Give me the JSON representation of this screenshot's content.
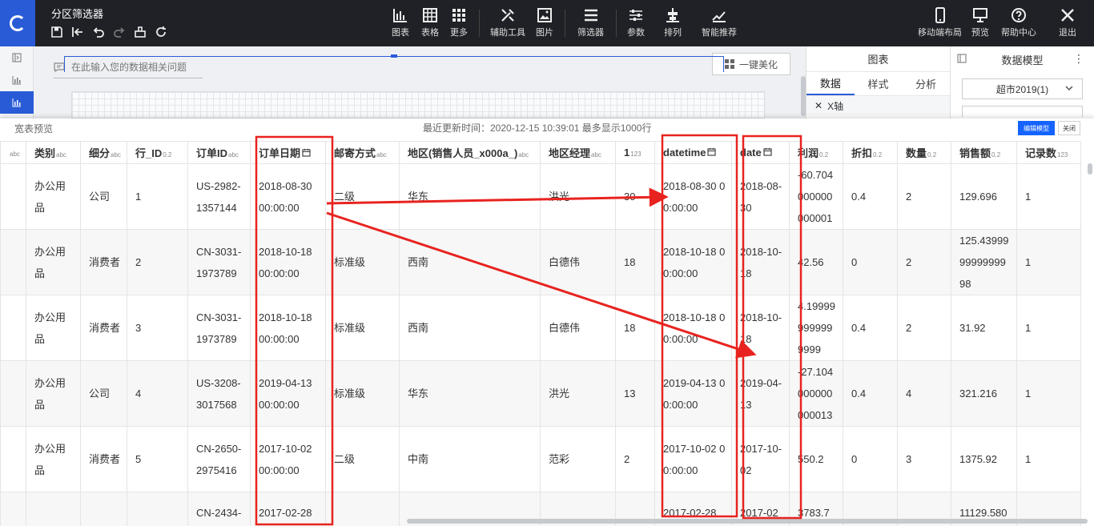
{
  "app": {
    "title": "分区筛选器"
  },
  "toolbar": {
    "tools": [
      {
        "name": "chart",
        "label": "图表"
      },
      {
        "name": "table",
        "label": "表格"
      },
      {
        "name": "more",
        "label": "更多"
      },
      {
        "name": "aux-tools",
        "label": "辅助工具"
      },
      {
        "name": "picture",
        "label": "图片"
      },
      {
        "name": "filter",
        "label": "筛选器"
      },
      {
        "name": "params",
        "label": "参数"
      },
      {
        "name": "arrange",
        "label": "排列"
      },
      {
        "name": "smart-recommend",
        "label": "智能推荐"
      },
      {
        "name": "mobile-layout",
        "label": "移动端布局"
      },
      {
        "name": "preview",
        "label": "预览"
      },
      {
        "name": "help",
        "label": "帮助中心"
      },
      {
        "name": "exit",
        "label": "退出"
      }
    ]
  },
  "canvas": {
    "question_placeholder": "在此输入您的数据相关问题",
    "beautify_label": "一键美化"
  },
  "chart_panel": {
    "title": "图表",
    "tabs": [
      "数据",
      "样式",
      "分析"
    ],
    "axis_label": "X轴"
  },
  "model_panel": {
    "title": "数据模型",
    "more": "⋮",
    "dataset": "超市2019(1)"
  },
  "preview": {
    "title": "宽表预览",
    "update_text": "最近更新时间：2020-12-15 10:39:01 最多显示1000行",
    "edit_model_label": "编辑模型",
    "close_label": "关闭",
    "columns": [
      {
        "label": "",
        "type": "abc"
      },
      {
        "label": "类别",
        "type": "abc"
      },
      {
        "label": "细分",
        "type": "abc"
      },
      {
        "label": "行_ID",
        "type": "0.2"
      },
      {
        "label": "订单ID",
        "type": "abc"
      },
      {
        "label": "订单日期",
        "type": ""
      },
      {
        "label": "邮寄方式",
        "type": "abc"
      },
      {
        "label": "地区(销售人员_x000a_)",
        "type": "abc"
      },
      {
        "label": "地区经理",
        "type": "abc"
      },
      {
        "label": "1",
        "type": "123"
      },
      {
        "label": "datetime",
        "type": ""
      },
      {
        "label": "date",
        "type": ""
      },
      {
        "label": "利润",
        "type": "0.2"
      },
      {
        "label": "折扣",
        "type": "0.2"
      },
      {
        "label": "数量",
        "type": "0.2"
      },
      {
        "label": "销售额",
        "type": "0.2"
      },
      {
        "label": "记录数",
        "type": "123"
      }
    ],
    "rows": [
      [
        "",
        "办公用品",
        "公司",
        "1",
        "US-2982-1357144",
        "2018-08-30 00:00:00",
        "二级",
        "华东",
        "洪光",
        "30",
        "2018-08-30 00:00:00",
        "2018-08-30",
        "-60.704000000000001",
        "0.4",
        "2",
        "129.696",
        "1"
      ],
      [
        "",
        "办公用品",
        "消费者",
        "2",
        "CN-3031-1973789",
        "2018-10-18 00:00:00",
        "标准级",
        "西南",
        "白德伟",
        "18",
        "2018-10-18 00:00:00",
        "2018-10-18",
        "42.56",
        "0",
        "2",
        "125.439999999999998",
        "1"
      ],
      [
        "",
        "办公用品",
        "消费者",
        "3",
        "CN-3031-1973789",
        "2018-10-18 00:00:00",
        "标准级",
        "西南",
        "白德伟",
        "18",
        "2018-10-18 00:00:00",
        "2018-10-18",
        "4.199999999999999",
        "0.4",
        "2",
        "31.92",
        "1"
      ],
      [
        "",
        "办公用品",
        "公司",
        "4",
        "US-3208-3017568",
        "2019-04-13 00:00:00",
        "标准级",
        "华东",
        "洪光",
        "13",
        "2019-04-13 00:00:00",
        "2019-04-13",
        "-27.104000000000013",
        "0.4",
        "4",
        "321.216",
        "1"
      ],
      [
        "",
        "办公用品",
        "消费者",
        "5",
        "CN-2650-2975416",
        "2017-10-02 00:00:00",
        "二级",
        "中南",
        "范彩",
        "2",
        "2017-10-02 00:00:00",
        "2017-10-02",
        "550.2",
        "0",
        "3",
        "1375.92",
        "1"
      ],
      [
        "",
        "",
        "",
        "",
        "CN-2434-",
        "2017-02-28",
        "",
        "",
        "",
        "",
        "2017-02-28",
        "2017-02",
        "3783.7",
        "",
        "",
        "11129.580",
        ""
      ]
    ]
  }
}
